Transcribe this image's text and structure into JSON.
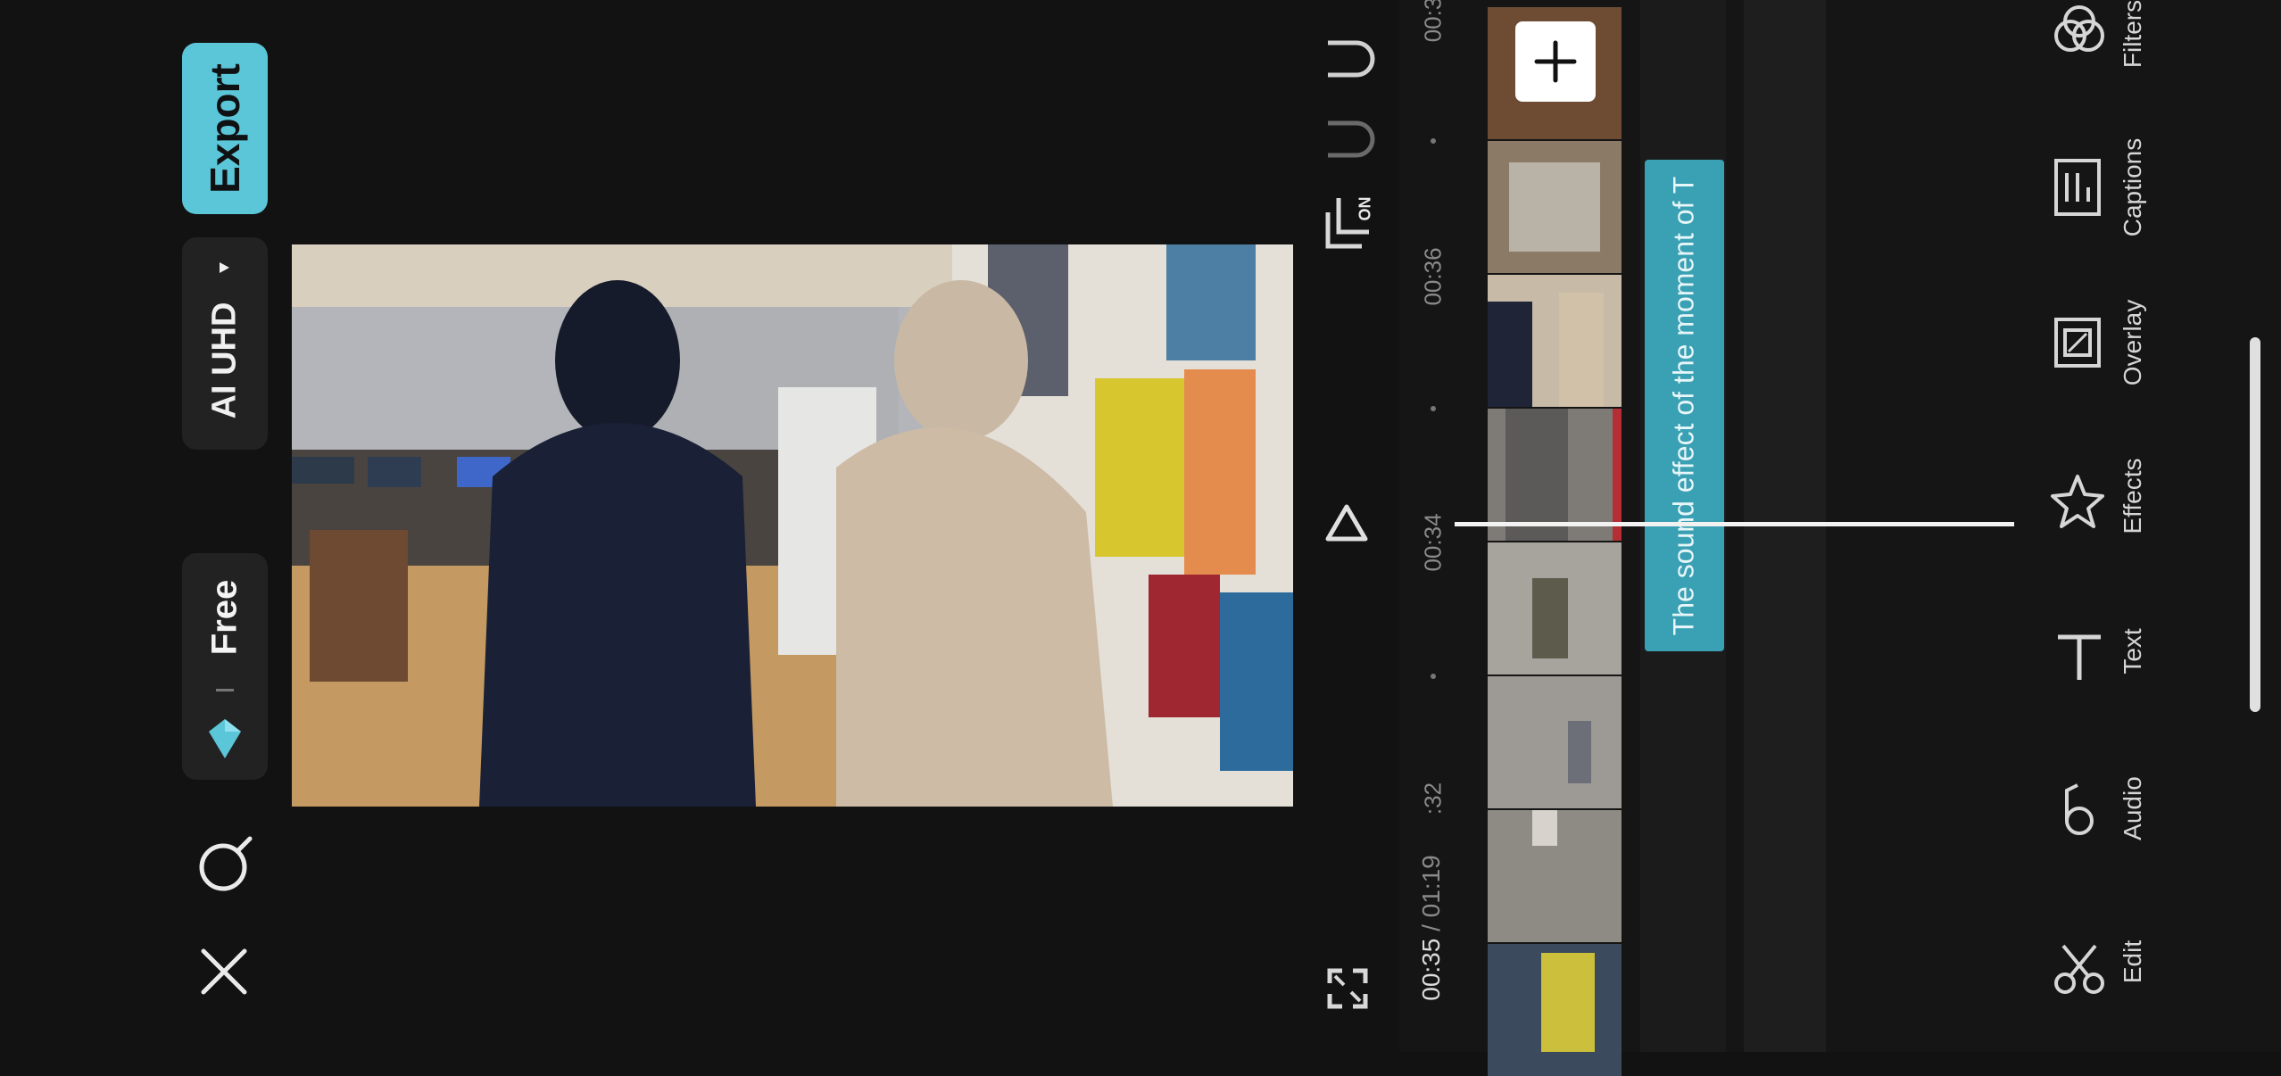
{
  "header": {
    "export_label": "Export",
    "resolution_label": "AI UHD",
    "free_label": "Free"
  },
  "preview": {
    "description_icon": "video-frame"
  },
  "timeline": {
    "current_time": "00:35",
    "total_time": "01:19",
    "tick_labels": [
      "00:3",
      "00:36",
      "00:34",
      ":32"
    ],
    "caption_clip_text": "The sound effect of the moment of T",
    "sync_toggle_label": "ON"
  },
  "tools": [
    {
      "label": "Filters",
      "icon": "filters-icon"
    },
    {
      "label": "Captions",
      "icon": "captions-icon"
    },
    {
      "label": "Overlay",
      "icon": "overlay-icon"
    },
    {
      "label": "Effects",
      "icon": "effects-icon"
    },
    {
      "label": "Text",
      "icon": "text-icon"
    },
    {
      "label": "Audio",
      "icon": "audio-icon"
    },
    {
      "label": "Edit",
      "icon": "edit-icon"
    }
  ],
  "colors": {
    "accent": "#5cc6d9",
    "caption_clip": "#3aa0b3",
    "background": "#121212"
  }
}
